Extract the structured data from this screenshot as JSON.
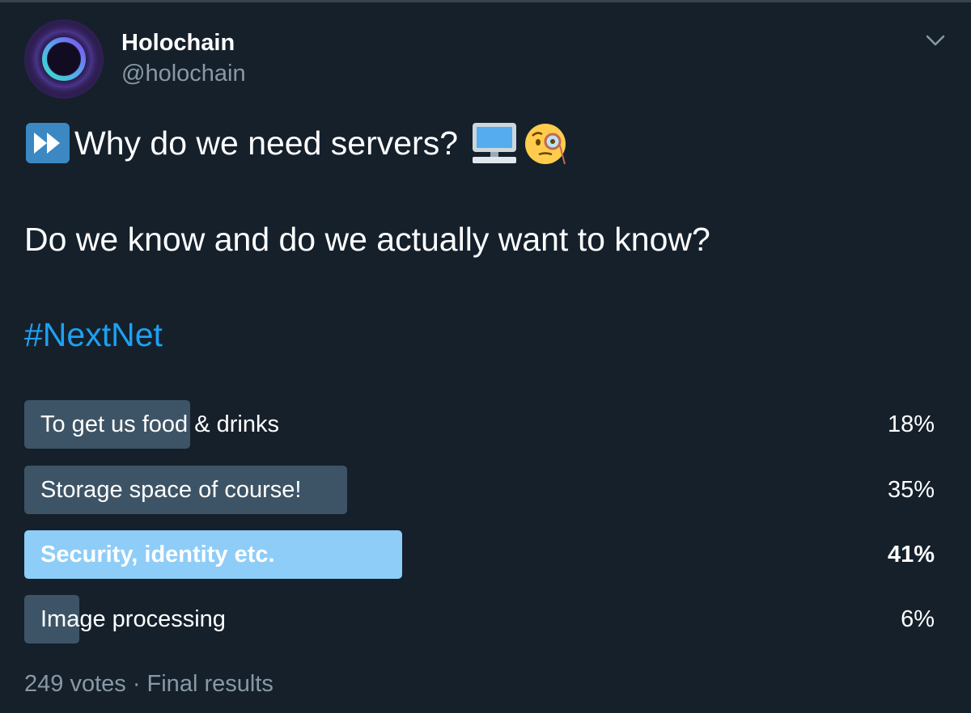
{
  "tweet": {
    "author": {
      "display_name": "Holochain",
      "handle": "@holochain",
      "avatar_icon": "holochain-ring-logo"
    },
    "menu_icon": "chevron-down-icon",
    "line1": "Why do we need servers?",
    "line1_emoji": [
      "fast-forward-icon",
      "desktop-computer-icon",
      "face-with-monocle-icon"
    ],
    "line2": "Do we know and do we actually want to know?",
    "hashtag": "#NextNet"
  },
  "poll": {
    "options": [
      {
        "label": "To get us food & drinks",
        "percent": 18,
        "percent_label": "18%",
        "winner": false
      },
      {
        "label": "Storage space of course!",
        "percent": 35,
        "percent_label": "35%",
        "winner": false
      },
      {
        "label": "Security, identity etc.",
        "percent": 41,
        "percent_label": "41%",
        "winner": true
      },
      {
        "label": "Image processing",
        "percent": 6,
        "percent_label": "6%",
        "winner": false
      }
    ],
    "footer": "249 votes · Final results"
  },
  "colors": {
    "background": "#15202b",
    "bar": "#3d5466",
    "winner_bar": "#8ecdf8",
    "link": "#1da1f2",
    "secondary_text": "#8899a6"
  }
}
